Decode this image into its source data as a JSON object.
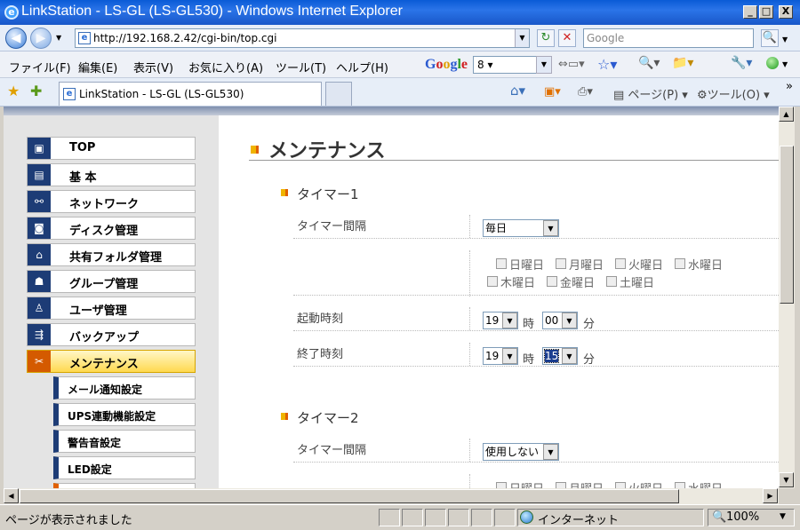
{
  "window": {
    "title": "LinkStation - LS-GL (LS-GL530) - Windows Internet Explorer",
    "logo_glyph": "e",
    "min": "_",
    "max": "□",
    "close": "X"
  },
  "addressbar": {
    "back": "◀",
    "forward": "▶",
    "url": "http://192.168.2.42/cgi-bin/top.cgi",
    "refresh": "↻",
    "stop": "✕",
    "search_placeholder": "Google",
    "search_go": "🔍"
  },
  "menubar": {
    "items": [
      "ファイル(F)",
      "編集(E)",
      "表示(V)",
      "お気に入り(A)",
      "ツール(T)",
      "ヘルプ(H)"
    ],
    "google_logo": "Google",
    "google_box": "8 ▾"
  },
  "tabbar": {
    "tab_title": "LinkStation - LS-GL (LS-GL530)",
    "page_menu": "ページ(P) ▾",
    "tools_menu": "ツール(O) ▾",
    "more": "»"
  },
  "sidebar": {
    "items": [
      {
        "label": "TOP",
        "icon": "monitor-icon",
        "glyph": "▣"
      },
      {
        "label": "基 本",
        "icon": "basic-icon",
        "glyph": "▤"
      },
      {
        "label": "ネットワーク",
        "icon": "network-icon",
        "glyph": "⚯"
      },
      {
        "label": "ディスク管理",
        "icon": "disk-icon",
        "glyph": "◙"
      },
      {
        "label": "共有フォルダ管理",
        "icon": "folder-icon",
        "glyph": "⌂"
      },
      {
        "label": "グループ管理",
        "icon": "group-icon",
        "glyph": "☗"
      },
      {
        "label": "ユーザ管理",
        "icon": "user-icon",
        "glyph": "♙"
      },
      {
        "label": "バックアップ",
        "icon": "backup-icon",
        "glyph": "⇶"
      },
      {
        "label": "メンテナンス",
        "icon": "maintenance-icon",
        "glyph": "✂"
      }
    ],
    "subitems": [
      "メール通知設定",
      "UPS連動機能設定",
      "警告音設定",
      "LED設定"
    ]
  },
  "main": {
    "title": "メンテナンス",
    "timer1": {
      "heading": "タイマー1",
      "interval_label": "タイマー間隔",
      "interval_value": "毎日",
      "days": [
        "日曜日",
        "月曜日",
        "火曜日",
        "水曜日",
        "木曜日",
        "金曜日",
        "土曜日"
      ],
      "start_label": "起動時刻",
      "start_hour": "19",
      "start_min": "00",
      "end_label": "終了時刻",
      "end_hour": "19",
      "end_min": "15",
      "hour_unit": "時",
      "min_unit": "分"
    },
    "timer2": {
      "heading": "タイマー2",
      "interval_label": "タイマー間隔",
      "interval_value": "使用しない",
      "days": [
        "日曜日",
        "月曜日",
        "火曜日",
        "水曜日"
      ]
    }
  },
  "statusbar": {
    "text": "ページが表示されました",
    "zone": "インターネット",
    "zoom": "100%"
  }
}
